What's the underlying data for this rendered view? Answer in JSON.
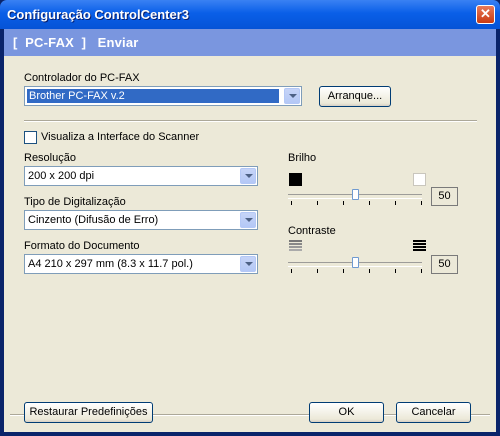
{
  "window": {
    "title": "Configuração ControlCenter3",
    "close_glyph": "✕"
  },
  "header": {
    "text": "[  PC-FAX  ]   Enviar"
  },
  "driver": {
    "label": "Controlador do PC-FAX",
    "selected": "Brother PC-FAX v.2",
    "setup_button": "Arranque..."
  },
  "scanner_interface": {
    "label": "Visualiza a Interface do Scanner",
    "checked": false
  },
  "resolution": {
    "label": "Resolução",
    "selected": "200 x 200 dpi"
  },
  "scan_type": {
    "label": "Tipo de Digitalização",
    "selected": "Cinzento (Difusão de Erro)"
  },
  "document_size": {
    "label": "Formato do Documento",
    "selected": "A4 210 x 297 mm (8.3 x 11.7 pol.)"
  },
  "brightness": {
    "label": "Brilho",
    "value": "50",
    "level": 0.5
  },
  "contrast": {
    "label": "Contraste",
    "value": "50",
    "level": 0.5
  },
  "footer": {
    "restore_button": "Restaurar Predefinições",
    "ok_button": "OK",
    "cancel_button": "Cancelar"
  },
  "icons": {
    "brightness_low": "black-square-icon",
    "brightness_high": "white-square-icon",
    "contrast_low": "low-contrast-icon",
    "contrast_high": "high-contrast-icon"
  }
}
